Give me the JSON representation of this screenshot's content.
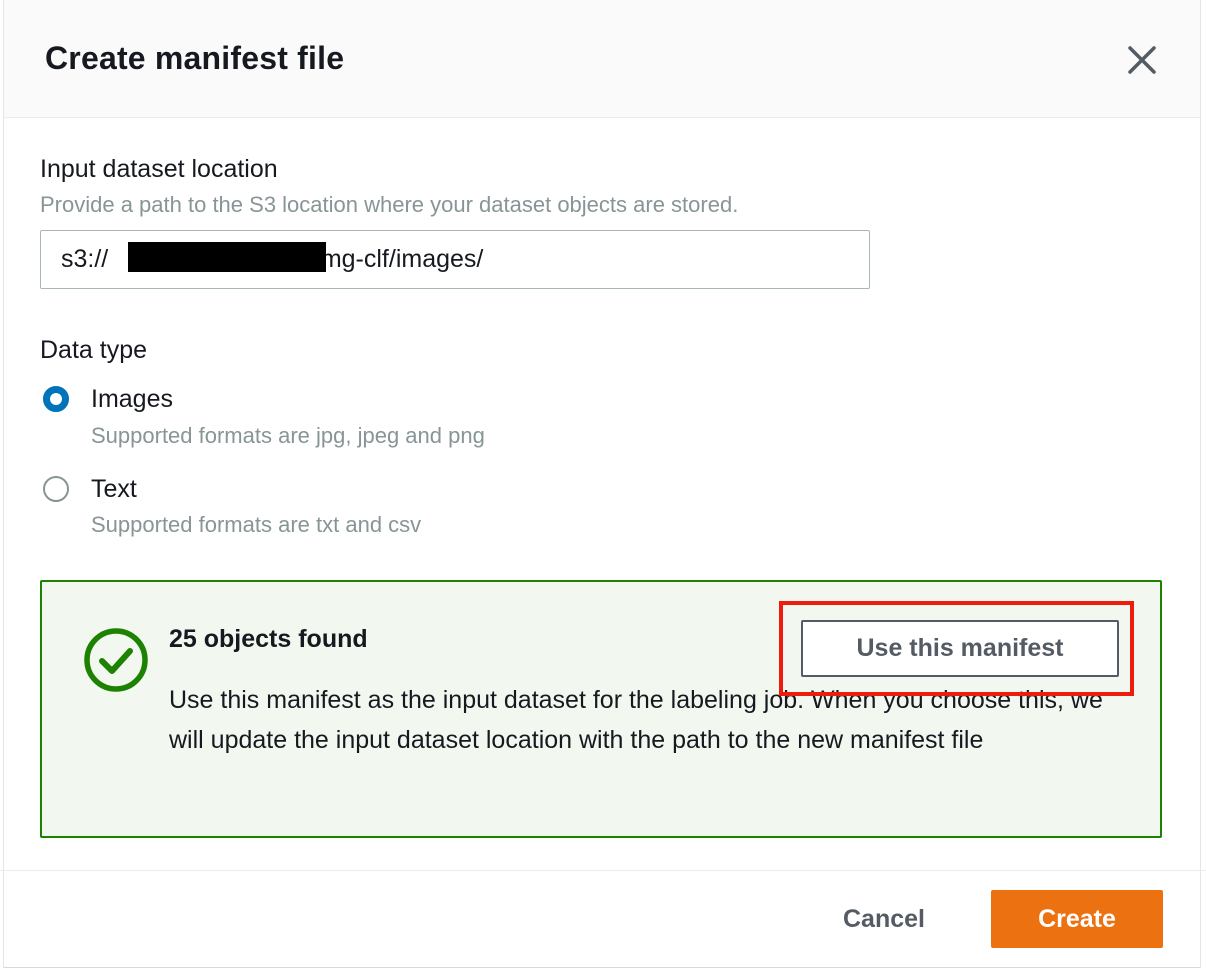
{
  "dialog": {
    "title": "Create manifest file",
    "close_icon": "close-icon"
  },
  "input_dataset": {
    "label": "Input dataset location",
    "description": "Provide a path to the S3 location where your dataset objects are stored.",
    "value": "s3://        /ground-truth-img-clf/images/"
  },
  "data_type": {
    "label": "Data type",
    "options": [
      {
        "label": "Images",
        "description": "Supported formats are jpg, jpeg and png",
        "selected": true
      },
      {
        "label": "Text",
        "description": "Supported formats are txt and csv",
        "selected": false
      }
    ]
  },
  "alert": {
    "icon": "success-check-icon",
    "title": "25 objects found",
    "body": "Use this manifest as the input dataset for the labeling job. When you choose this, we will update the input dataset location with the path to the new manifest file",
    "button_label": "Use this manifest"
  },
  "footer": {
    "cancel_label": "Cancel",
    "create_label": "Create"
  },
  "colors": {
    "primary_button": "#ec7211",
    "success": "#1d8102",
    "radio_selected": "#0073bb",
    "annotation_highlight": "#ee1c0c"
  }
}
